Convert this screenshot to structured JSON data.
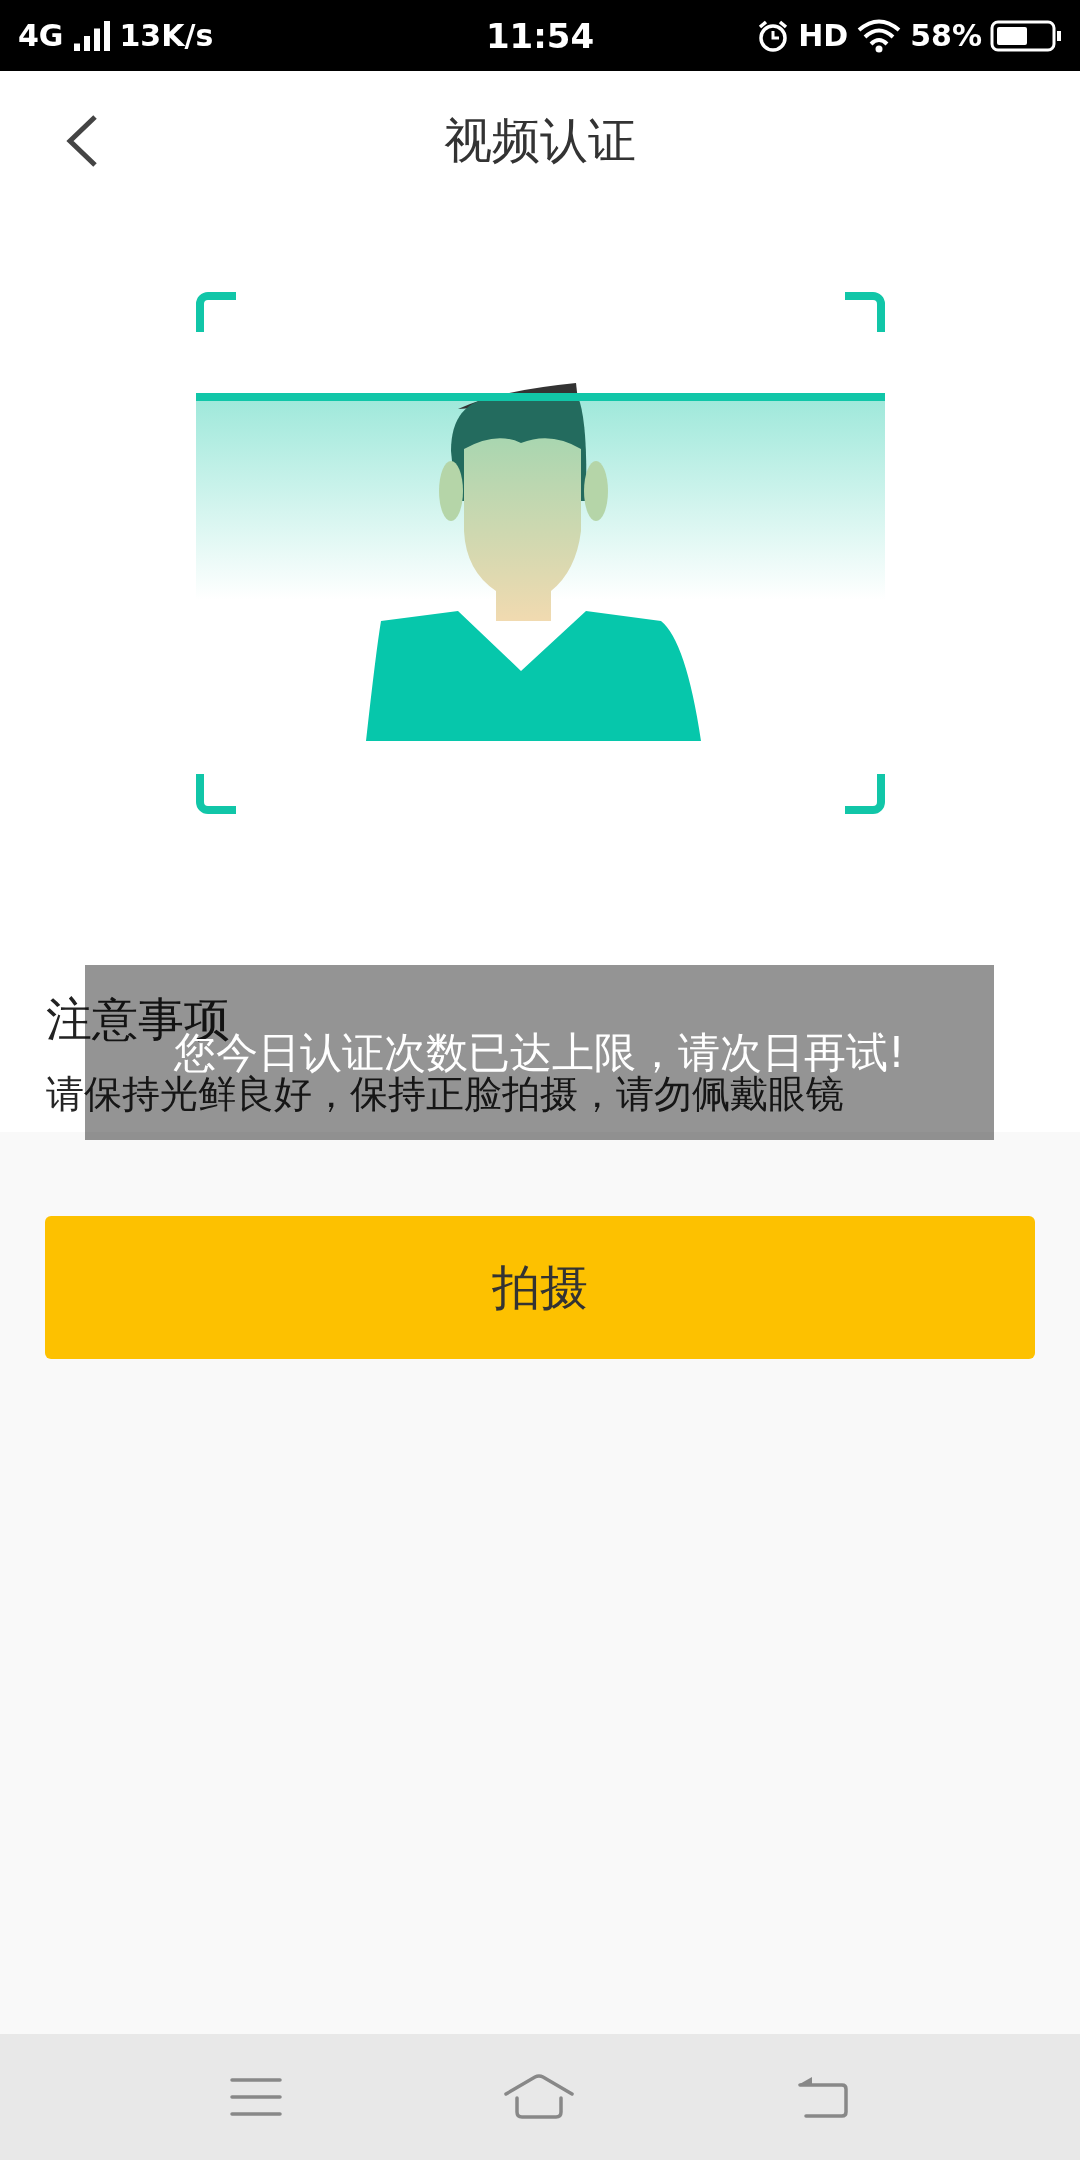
{
  "status_bar": {
    "network": "4G",
    "speed": "13K/s",
    "time": "11:54",
    "hd": "HD",
    "battery": "58%"
  },
  "header": {
    "title": "视频认证"
  },
  "capture": {
    "kind": "picture",
    "scan_line": true
  },
  "notice": {
    "title": "注意事项",
    "text": "请保持光鲜良好，保持正脸拍摄，请勿佩戴眼镜"
  },
  "shoot_button": {
    "label": "拍摄"
  },
  "toast": {
    "text": "您今日认证次数已达上限，请次日再试!"
  }
}
